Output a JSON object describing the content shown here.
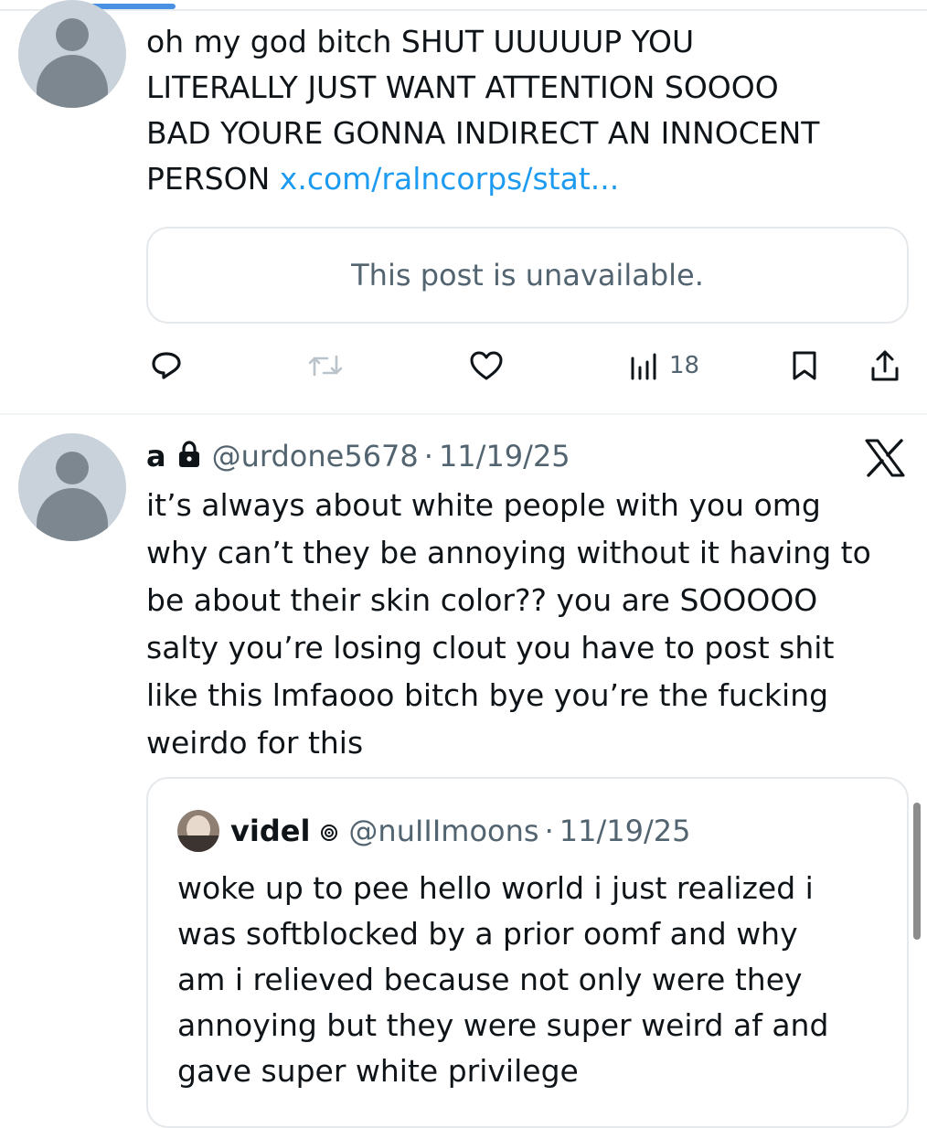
{
  "tweet1": {
    "lines": [
      "oh my god bitch SHUT UUUUUP YOU",
      "LITERALLY JUST WANT ATTENTION SOOOO",
      "BAD YOURE GONNA INDIRECT AN INNOCENT",
      "PERSON"
    ],
    "link": "x.com/ralncorps/stat...",
    "quote_unavailable": "This post is unavailable.",
    "views": "18",
    "actions": {
      "reply": "reply-icon",
      "repost": "repost-icon",
      "like": "heart-icon",
      "views": "bar-chart-icon",
      "bookmark": "bookmark-icon",
      "share": "share-icon"
    }
  },
  "tweet2": {
    "name": "a",
    "lock": "lock-icon",
    "handle": "@urdone5678",
    "sep": "·",
    "date": "11/19/25",
    "logo": "x-logo",
    "lines": [
      "it’s always about white people with you omg",
      "why can’t they be annoying without it having to",
      "be about their skin color?? you are SOOOOO",
      "salty you’re losing clout you have to post shit",
      "like this lmfaooo bitch bye you’re the fucking",
      "weirdo for this"
    ],
    "quote": {
      "name": "videl",
      "badge": "spiral-icon",
      "handle": "@nuIIImoons",
      "sep": "·",
      "date": "11/19/25",
      "lines": [
        "woke up to pee hello world i just realized i",
        "was softblocked by a prior oomf and why",
        "am i relieved because not only were they",
        "annoying but they were super weird af and",
        "gave super white privilege"
      ]
    }
  },
  "colors": {
    "link": "#1d9bf0",
    "muted": "#536471",
    "text": "#0f1419",
    "border": "#e6e9ec",
    "accent": "#4a90e2"
  }
}
